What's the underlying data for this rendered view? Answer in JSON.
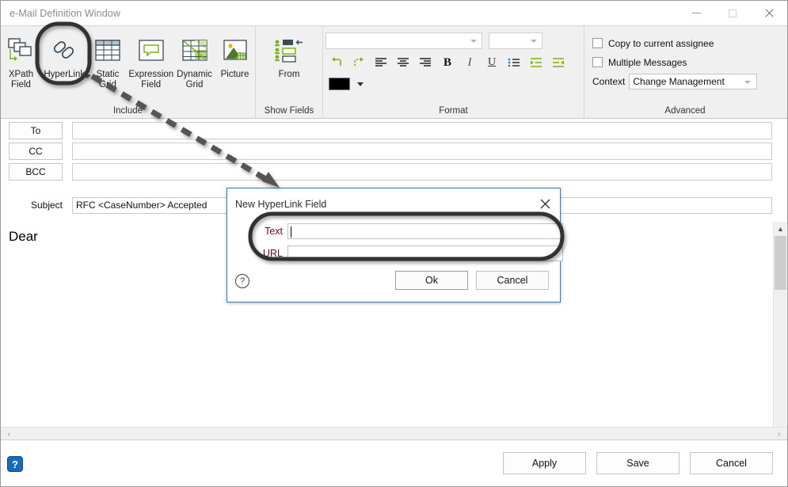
{
  "window": {
    "title": "e-Mail Definition Window",
    "controls": {
      "minimize": "minimize-icon",
      "maximize": "maximize-icon",
      "close": "close-icon"
    }
  },
  "ribbon": {
    "groups": [
      {
        "label": "Include",
        "buttons": [
          {
            "label_line1": "XPath",
            "label_line2": "Field",
            "icon": "xpath-field-icon"
          },
          {
            "label_line1": "HyperLink",
            "label_line2": "",
            "icon": "hyperlink-icon"
          },
          {
            "label_line1": "Static",
            "label_line2": "Grid",
            "icon": "static-grid-icon"
          },
          {
            "label_line1": "Expression",
            "label_line2": "Field",
            "icon": "expression-field-icon"
          },
          {
            "label_line1": "Dynamic",
            "label_line2": "Grid",
            "icon": "dynamic-grid-icon"
          },
          {
            "label_line1": "Picture",
            "label_line2": "",
            "icon": "picture-icon"
          }
        ]
      },
      {
        "label": "Show Fields",
        "buttons": [
          {
            "label_line1": "From",
            "label_line2": "",
            "icon": "from-field-icon"
          }
        ]
      },
      {
        "label": "Format",
        "font_combo": {
          "value": "",
          "placeholder": ""
        },
        "size_combo": {
          "value": "",
          "placeholder": ""
        },
        "tools": [
          {
            "name": "undo-icon",
            "title": "Undo"
          },
          {
            "name": "redo-icon",
            "title": "Redo"
          },
          {
            "name": "align-left-icon",
            "title": "Align Left"
          },
          {
            "name": "align-center-icon",
            "title": "Align Center"
          },
          {
            "name": "align-right-icon",
            "title": "Align Right"
          },
          {
            "name": "bold-icon",
            "title": "Bold",
            "glyph": "B"
          },
          {
            "name": "italic-icon",
            "title": "Italic",
            "glyph": "I"
          },
          {
            "name": "underline-icon",
            "title": "Underline",
            "glyph": "U"
          },
          {
            "name": "bullet-list-icon",
            "title": "Bullets"
          },
          {
            "name": "increase-indent-icon",
            "title": "Increase Indent"
          },
          {
            "name": "decrease-indent-icon",
            "title": "Decrease Indent"
          }
        ],
        "color_swatch": {
          "name": "font-color-swatch",
          "value": "#000000"
        }
      },
      {
        "label": "Advanced",
        "checkboxes": [
          {
            "label": "Copy to current assignee",
            "checked": false
          },
          {
            "label": "Multiple Messages",
            "checked": false
          }
        ],
        "context": {
          "label": "Context",
          "value": "Change Management"
        }
      }
    ]
  },
  "mail": {
    "to_label": "To",
    "cc_label": "CC",
    "bcc_label": "BCC",
    "to_value": "",
    "cc_value": "",
    "bcc_value": "",
    "subject_label": "Subject",
    "subject_value": "RFC <CaseNumber> Accepted",
    "body_text": "Dear"
  },
  "dialog": {
    "title": "New HyperLink Field",
    "close_icon": "close-icon",
    "text_label": "Text",
    "text_value": "",
    "url_label": "URL",
    "url_value": "",
    "ok_label": "Ok",
    "cancel_label": "Cancel",
    "help_glyph": "?"
  },
  "footer": {
    "help_glyph": "?",
    "apply_label": "Apply",
    "save_label": "Save",
    "cancel_label": "Cancel"
  },
  "scrollbars": {
    "v_up": "▲",
    "v_down": "▼",
    "h_left": "‹",
    "h_right": "›"
  },
  "colors": {
    "accent_green": "#7ab317",
    "dialog_border": "#2e7fc4",
    "label_maroon": "#5a1111",
    "ribbon_bg": "#f0f0f0"
  }
}
